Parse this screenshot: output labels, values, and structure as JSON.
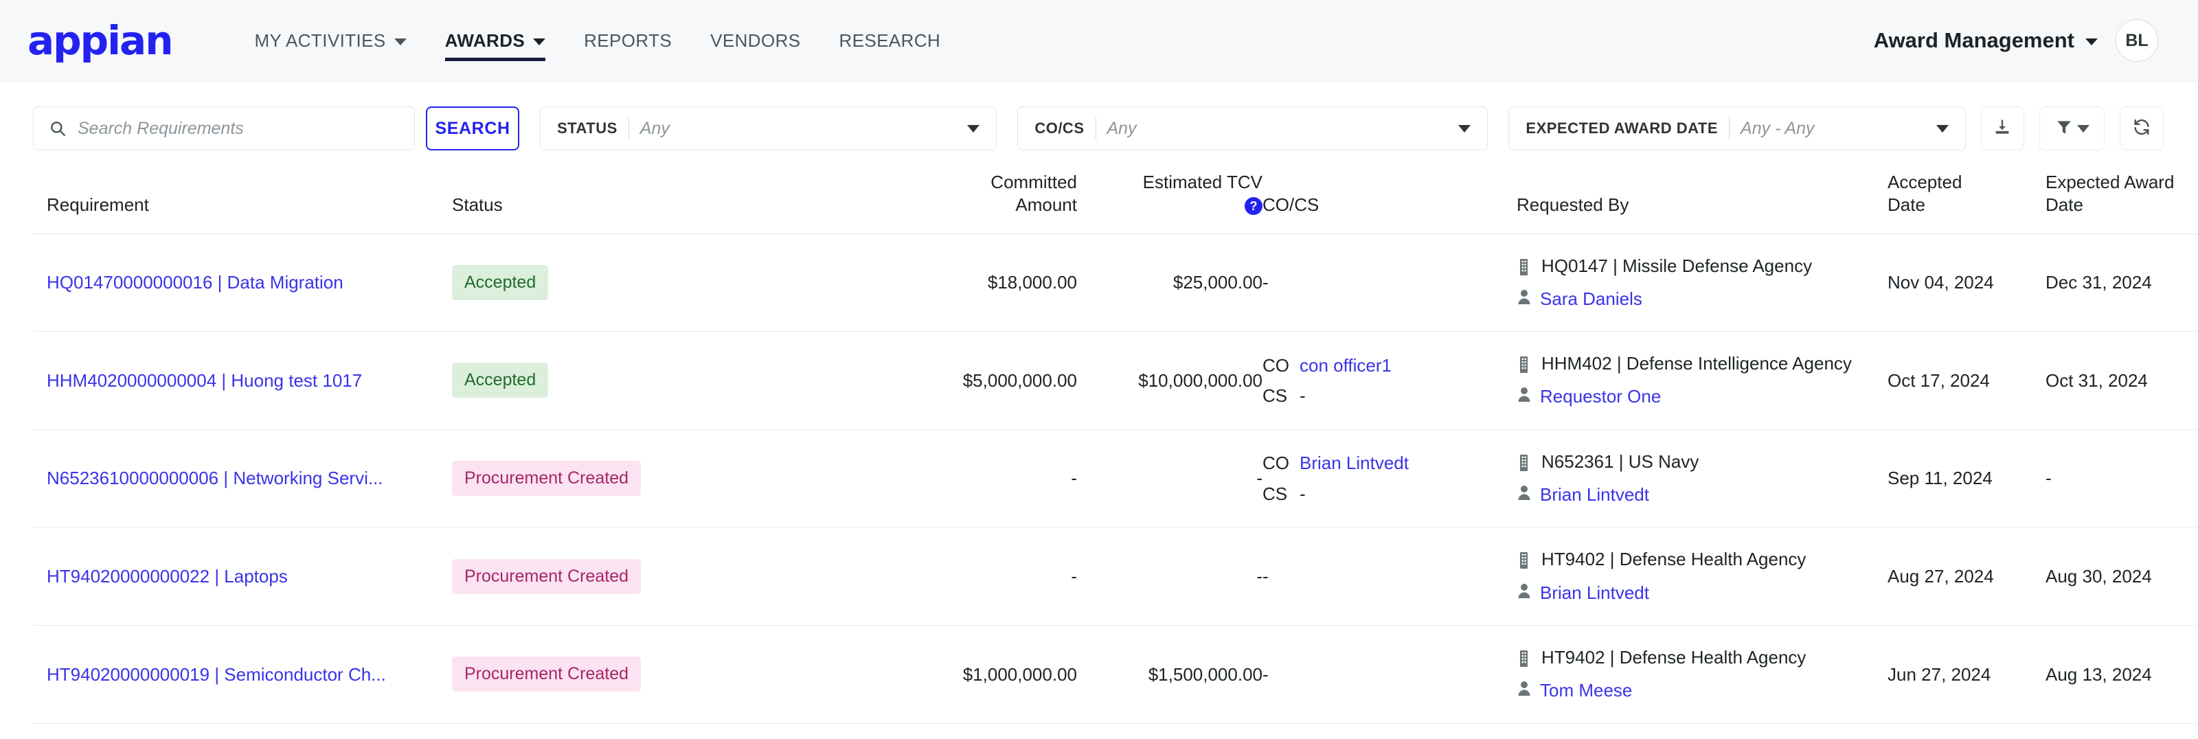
{
  "brand": {
    "logo_text": "appian"
  },
  "nav": {
    "items": [
      {
        "label": "MY ACTIVITIES",
        "has_caret": true,
        "active": false
      },
      {
        "label": "AWARDS",
        "has_caret": true,
        "active": true
      },
      {
        "label": "REPORTS",
        "has_caret": false,
        "active": false
      },
      {
        "label": "VENDORS",
        "has_caret": false,
        "active": false
      },
      {
        "label": "RESEARCH",
        "has_caret": false,
        "active": false
      }
    ]
  },
  "header": {
    "app_title": "Award Management",
    "avatar_initials": "BL"
  },
  "toolbar": {
    "search_placeholder": "Search Requirements",
    "search_value": "",
    "search_button": "SEARCH",
    "filters": [
      {
        "label": "STATUS",
        "value": "Any"
      },
      {
        "label": "CO/CS",
        "value": "Any"
      },
      {
        "label": "EXPECTED AWARD DATE",
        "value": "Any - Any"
      }
    ],
    "buttons": [
      {
        "name": "download-icon",
        "label": ""
      },
      {
        "name": "filter-icon",
        "label": ""
      },
      {
        "name": "refresh-icon",
        "label": ""
      }
    ]
  },
  "table": {
    "columns": [
      "Requirement",
      "Status",
      "Committed Amount",
      "Estimated TCV",
      "CO/CS",
      "Requested By",
      "Accepted Date",
      "Expected Award Date"
    ],
    "columns_split": {
      "requirement": "Requirement",
      "status": "Status",
      "committed_line1": "Committed",
      "committed_line2": "Amount",
      "tcv_line1": "Estimated TCV",
      "tcv_help": "?",
      "cocs": "CO/CS",
      "requested_by": "Requested By",
      "accepted_line1": "Accepted",
      "accepted_line2": "Date",
      "expected_line1": "Expected Award",
      "expected_line2": "Date"
    },
    "rows": [
      {
        "requirement": "HQ01470000000016 | Data Migration",
        "status": "Accepted",
        "status_type": "accepted",
        "committed_amount": "$18,000.00",
        "estimated_tcv": "$25,000.00",
        "co_key": "",
        "co_value": "",
        "cs_key": "",
        "cs_value": "",
        "cocs_plain": "-",
        "org": "HQ0147 | Missile Defense Agency",
        "person": "Sara Daniels",
        "accepted_date": "Nov 04, 2024",
        "expected_date": "Dec 31, 2024"
      },
      {
        "requirement": "HHM4020000000004 | Huong test 1017",
        "status": "Accepted",
        "status_type": "accepted",
        "committed_amount": "$5,000,000.00",
        "estimated_tcv": "$10,000,000.00",
        "co_key": "CO",
        "co_value": "con officer1",
        "co_is_link": true,
        "cs_key": "CS",
        "cs_value": "-",
        "cs_is_link": false,
        "cocs_plain": "",
        "org": "HHM402 | Defense Intelligence Agency",
        "person": "Requestor One",
        "accepted_date": "Oct 17, 2024",
        "expected_date": "Oct 31, 2024"
      },
      {
        "requirement": "N6523610000000006 | Networking Servi...",
        "status": "Procurement Created",
        "status_type": "procurement",
        "committed_amount": "-",
        "estimated_tcv": "-",
        "co_key": "CO",
        "co_value": "Brian Lintvedt",
        "co_is_link": true,
        "cs_key": "CS",
        "cs_value": "-",
        "cs_is_link": false,
        "cocs_plain": "",
        "org": "N652361 | US Navy",
        "person": "Brian Lintvedt",
        "accepted_date": "Sep 11, 2024",
        "expected_date": "-"
      },
      {
        "requirement": "HT94020000000022 | Laptops",
        "status": "Procurement Created",
        "status_type": "procurement",
        "committed_amount": "-",
        "estimated_tcv": "-",
        "co_key": "",
        "co_value": "",
        "cs_key": "",
        "cs_value": "",
        "cocs_plain": "-",
        "org": "HT9402 | Defense Health Agency",
        "person": "Brian Lintvedt",
        "accepted_date": "Aug 27, 2024",
        "expected_date": "Aug 30, 2024"
      },
      {
        "requirement": "HT94020000000019 | Semiconductor Ch...",
        "status": "Procurement Created",
        "status_type": "procurement",
        "committed_amount": "$1,000,000.00",
        "estimated_tcv": "$1,500,000.00",
        "co_key": "",
        "co_value": "",
        "cs_key": "",
        "cs_value": "",
        "cocs_plain": "-",
        "org": "HT9402 | Defense Health Agency",
        "person": "Tom Meese",
        "accepted_date": "Jun 27, 2024",
        "expected_date": "Aug 13, 2024"
      }
    ]
  },
  "colors": {
    "brand_blue": "#2322f0",
    "link_blue": "#3a33e8",
    "accepted_bg": "#dcefdc",
    "accepted_fg": "#216c29",
    "procurement_bg": "#fbe3f1",
    "procurement_fg": "#a52669",
    "topbar_bg": "#f7f8f9"
  }
}
